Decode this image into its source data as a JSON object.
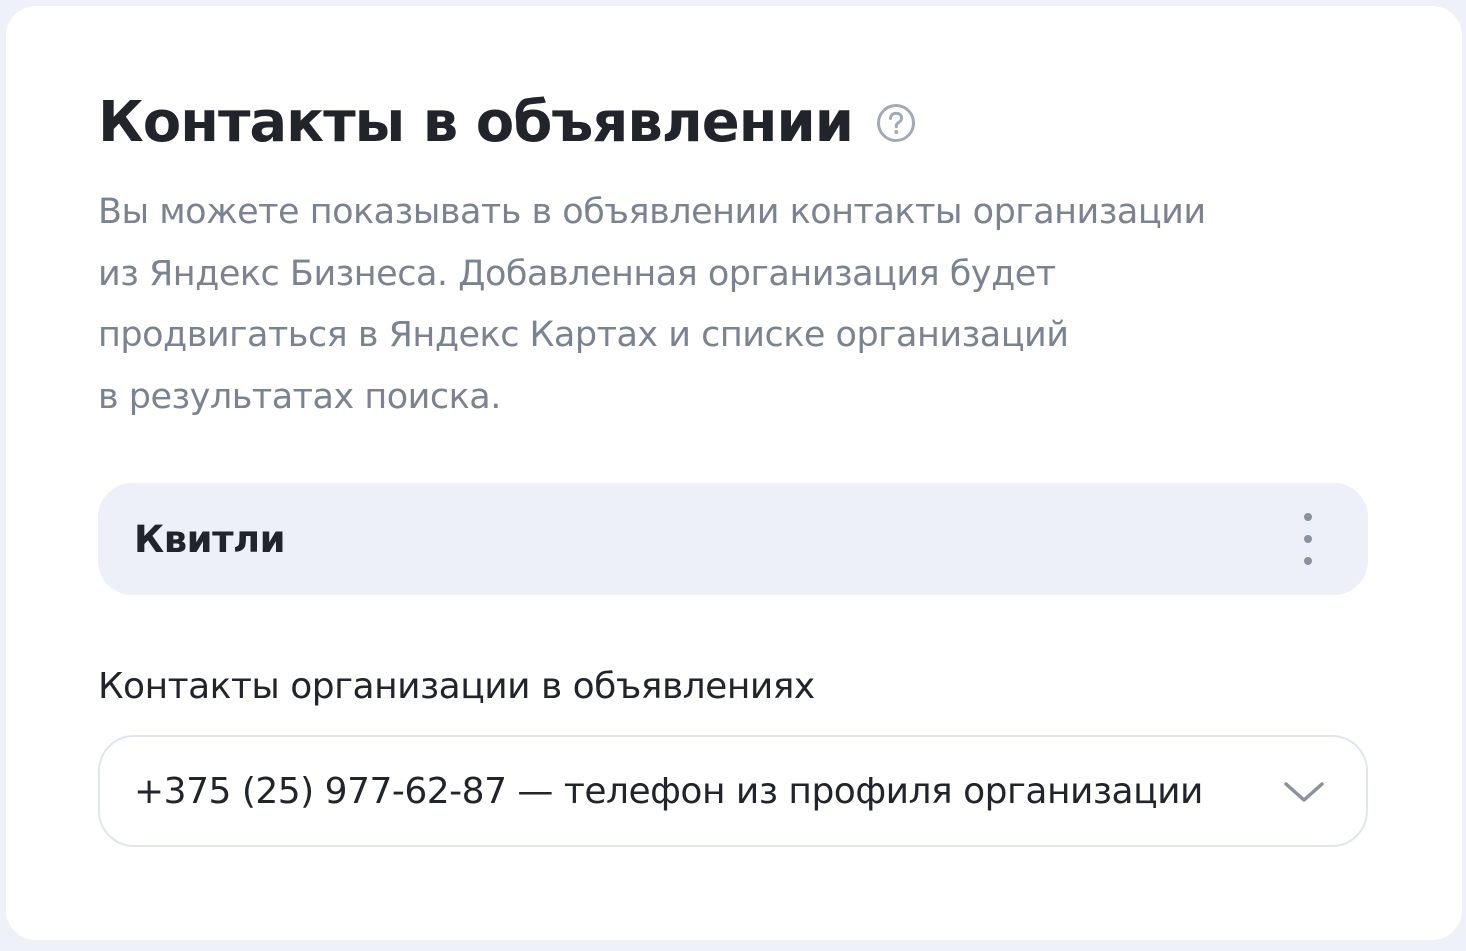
{
  "section": {
    "title": "Контакты в объявлении",
    "description_lines": [
      "Вы можете показывать в объявлении контакты организации",
      "из Яндекс Бизнеса. Добавленная организация будет",
      "продвигаться в Яндекс Картах и списке организаций",
      "в результатах поиска."
    ]
  },
  "organization": {
    "name": "Квитли",
    "menu_icon": "more-vertical-icon"
  },
  "contacts_field": {
    "label": "Контакты организации в объявлениях",
    "selected_value": "+375 (25) 977-62-87 — телефон из профиля организации",
    "icon": "chevron-down-icon"
  },
  "icons": {
    "help": "help-circle-icon"
  },
  "colors": {
    "page_background": "#eef1f7",
    "card_background": "#ffffff",
    "org_card_background": "#edf0f8",
    "primary_text": "#21242b",
    "secondary_text": "#7b8393"
  }
}
